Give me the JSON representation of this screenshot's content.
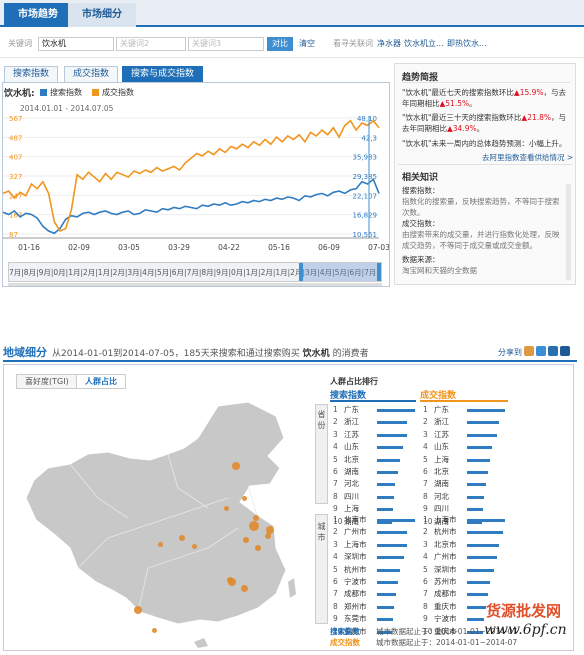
{
  "top_tabs": [
    "市场趋势",
    "市场细分"
  ],
  "keyword_row": {
    "label": "关键词",
    "kw1": "饮水机",
    "kw2": "关键词2",
    "kw3": "关键词3",
    "compare": "对比",
    "clear": "清空",
    "related_label": "看寻关联词",
    "related": [
      "净水器",
      "饮水机立...",
      "即热饮水..."
    ]
  },
  "chart_tabs": [
    "搜索指数",
    "成交指数",
    "搜索与成交指数"
  ],
  "chart_header": {
    "keyword": "饮水机:",
    "legend_search": "搜索指数",
    "legend_deal": "成交指数",
    "date_range": "2014.01.01 - 2014.07.05"
  },
  "chart_data": {
    "type": "line",
    "x_ticks": [
      "01-16",
      "02-09",
      "03-05",
      "03-29",
      "04-22",
      "05-16",
      "06-09",
      "07-03"
    ],
    "left_axis_ticks": [
      "567",
      "487",
      "407",
      "327",
      "247",
      "167",
      "87"
    ],
    "right_axis_ticks": [
      "48,10",
      "42,3",
      "35,983",
      "29,385",
      "22,107",
      "16,829",
      "10,551"
    ],
    "series": [
      {
        "name": "搜索指数",
        "color": "#2f7cc1",
        "values": [
          170,
          160,
          175,
          150,
          165,
          160,
          145,
          110,
          90,
          80,
          100,
          140,
          155,
          150,
          165,
          170,
          160,
          170,
          175,
          165,
          160,
          170,
          175,
          160,
          165,
          180,
          175,
          170,
          185,
          180,
          190,
          185,
          195,
          190,
          185,
          200,
          195,
          205,
          200,
          210,
          200,
          205,
          215,
          210,
          220,
          215,
          225,
          220,
          230,
          225,
          235,
          230,
          220,
          240,
          235,
          245,
          250,
          240,
          255,
          260,
          250,
          265,
          270,
          300,
          290,
          310,
          250
        ]
      },
      {
        "name": "成交指数",
        "color": "#f0951e",
        "values": [
          250,
          260,
          230,
          255,
          240,
          290,
          270,
          300,
          250,
          130,
          90,
          100,
          180,
          330,
          310,
          340,
          320,
          300,
          335,
          310,
          340,
          330,
          320,
          345,
          335,
          350,
          340,
          360,
          345,
          355,
          365,
          350,
          380,
          400,
          420,
          410,
          430,
          415,
          440,
          425,
          450,
          440,
          460,
          445,
          470,
          455,
          480,
          460,
          490,
          470,
          495,
          480,
          500,
          470,
          510,
          495,
          520,
          500,
          530,
          490,
          540,
          560,
          520,
          550,
          540,
          560,
          530
        ]
      }
    ],
    "ylim": [
      60,
      580
    ]
  },
  "timeline_labels": [
    "7月",
    "8月",
    "9月",
    "0月",
    "1月",
    "2月",
    "1月",
    "2月",
    "3月",
    "4月",
    "5月",
    "6月",
    "7月",
    "8月",
    "9月",
    "0月",
    "1月",
    "2月",
    "1月",
    "2月",
    "3月",
    "4月",
    "5月",
    "6月",
    "7月",
    "8月",
    "9月",
    "0月",
    "1月",
    "2月",
    "1月",
    "2月",
    "3月",
    "4月",
    "5月",
    "6月",
    "7月"
  ],
  "trend": {
    "title": "趋势简报",
    "items": [
      {
        "pre": "\"饮水机\"最近七天的搜索指数环比",
        "v1": "15.9%",
        "mid": "，与去年同期相比",
        "v2": "51.5%",
        "end": "。"
      },
      {
        "pre": "\"饮水机\"最近三十天的搜索指数环比",
        "v1": "21.8%",
        "mid": "，与去年同期相比",
        "v2": "34.9%",
        "end": "。"
      },
      {
        "pre": "\"饮水机\"未来一周内的总体趋势预测：小幅上升。",
        "v1": "",
        "mid": "",
        "v2": "",
        "end": ""
      }
    ],
    "more": "去阿里指数查看供给情况 >"
  },
  "knowledge": {
    "title": "相关知识",
    "items": [
      {
        "head": "搜索指数：",
        "body": "指数化的搜索量，反映搜索趋势，不等同于搜索次数。"
      },
      {
        "head": "成交指数：",
        "body": "由搜索带来的成交量，并进行指数化处理，反映成交趋势，不等同于成交量或成交金额。"
      },
      {
        "head": "数据来源：",
        "body": "淘宝网和天猫的全数据"
      }
    ]
  },
  "region": {
    "title": "地域细分",
    "sub_pre": "从2014-01-01到2014-07-05，185天来搜索和通过搜索购买",
    "keyword": "饮水机",
    "sub_post": "的消费者",
    "share": "分享到"
  },
  "map_tabs": [
    "喜好度(TGI)",
    "人群占比"
  ],
  "rank": {
    "title": "人群占比排行",
    "search_header": "搜索指数",
    "deal_header": "成交指数",
    "cat_province": "省份",
    "cat_city": "城市",
    "province_search": [
      "广东",
      "浙江",
      "江苏",
      "山东",
      "北京",
      "湖南",
      "河北",
      "四川",
      "上海",
      "湖南"
    ],
    "province_search_share": [
      1.0,
      0.8,
      0.78,
      0.68,
      0.6,
      0.55,
      0.48,
      0.45,
      0.42,
      0.4
    ],
    "province_deal": [
      "广东",
      "浙江",
      "江苏",
      "山东",
      "上海",
      "北京",
      "湖南",
      "河北",
      "四川",
      "湖南"
    ],
    "province_deal_share": [
      1.0,
      0.85,
      0.78,
      0.65,
      0.6,
      0.55,
      0.5,
      0.45,
      0.42,
      0.4
    ],
    "city_search": [
      "北京市",
      "广州市",
      "上海市",
      "深圳市",
      "杭州市",
      "宁波市",
      "成都市",
      "郑州市",
      "东莞市",
      "重庆市"
    ],
    "city_search_share": [
      1.0,
      0.8,
      0.78,
      0.7,
      0.6,
      0.55,
      0.5,
      0.45,
      0.42,
      0.4
    ],
    "city_deal": [
      "上海市",
      "杭州市",
      "北京市",
      "广州市",
      "深圳市",
      "苏州市",
      "成都市",
      "重庆市",
      "宁波市",
      "重庆市"
    ],
    "city_deal_share": [
      1.0,
      0.95,
      0.85,
      0.8,
      0.7,
      0.6,
      0.55,
      0.5,
      0.45,
      0.42
    ],
    "foot_search_label": "搜索指数",
    "foot_deal_label": "成交指数",
    "foot_search_date": "城市数据起止于：2014-01-01~2014-07",
    "foot_deal_date": "城市数据起止于：2014-01-01~2014-07"
  },
  "watermark": "货源批发网",
  "watermark_url": "www.6pf.cn",
  "colors": {
    "primary": "#1e6fb8",
    "search": "#2f7cc1",
    "deal": "#f0951e",
    "map_dot": "#e08a2a"
  }
}
